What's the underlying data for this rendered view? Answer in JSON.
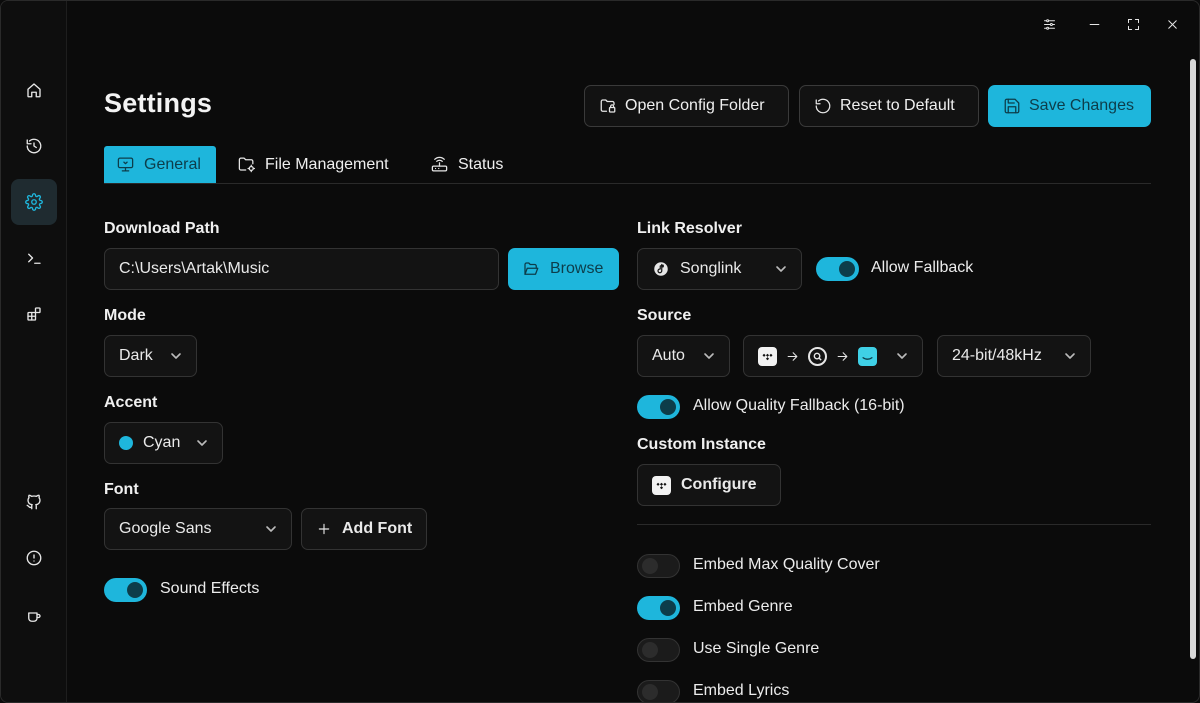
{
  "colors": {
    "accent": "#1eb6dc",
    "background": "#0b0b0b"
  },
  "sidebar": {
    "items": [
      {
        "name": "home",
        "icon": "home-icon"
      },
      {
        "name": "history",
        "icon": "history-icon"
      },
      {
        "name": "settings",
        "icon": "gear-icon",
        "active": true
      },
      {
        "name": "terminal",
        "icon": "terminal-icon"
      },
      {
        "name": "apps",
        "icon": "apps-icon"
      },
      {
        "name": "github",
        "icon": "github-icon"
      },
      {
        "name": "about",
        "icon": "info-icon"
      },
      {
        "name": "support",
        "icon": "coffee-icon"
      }
    ]
  },
  "window_controls": [
    "sliders-icon",
    "minimize-icon",
    "maximize-icon",
    "close-icon"
  ],
  "header": {
    "title": "Settings",
    "open_config_label": "Open Config Folder",
    "reset_label": "Reset to Default",
    "save_label": "Save Changes"
  },
  "tabs": [
    {
      "label": "General",
      "icon": "monitor-icon",
      "active": true
    },
    {
      "label": "File Management",
      "icon": "folder-gear-icon"
    },
    {
      "label": "Status",
      "icon": "router-icon"
    }
  ],
  "general": {
    "download_path": {
      "label": "Download Path",
      "value": "C:\\Users\\Artak\\Music",
      "browse_label": "Browse"
    },
    "mode": {
      "label": "Mode",
      "value": "Dark"
    },
    "accent": {
      "label": "Accent",
      "value": "Cyan",
      "color": "#1eb6dc"
    },
    "font": {
      "label": "Font",
      "value": "Google Sans",
      "add_label": "Add Font"
    },
    "sound_effects": {
      "label": "Sound Effects",
      "on": true
    },
    "link_resolver": {
      "label": "Link Resolver",
      "value": "Songlink"
    },
    "allow_fallback": {
      "label": "Allow Fallback",
      "on": true
    },
    "source": {
      "label": "Source",
      "value": "Auto",
      "chain": [
        "tidal-icon",
        "qobuz-icon",
        "amazon-icon"
      ],
      "quality": "24-bit/48kHz"
    },
    "allow_quality_fallback": {
      "label": "Allow Quality Fallback (16-bit)",
      "on": true
    },
    "custom_instance": {
      "label": "Custom Instance",
      "configure_label": "Configure"
    },
    "toggles": [
      {
        "label": "Embed Max Quality Cover",
        "on": false
      },
      {
        "label": "Embed Genre",
        "on": true
      },
      {
        "label": "Use Single Genre",
        "on": false
      },
      {
        "label": "Embed Lyrics",
        "on": false
      }
    ]
  }
}
